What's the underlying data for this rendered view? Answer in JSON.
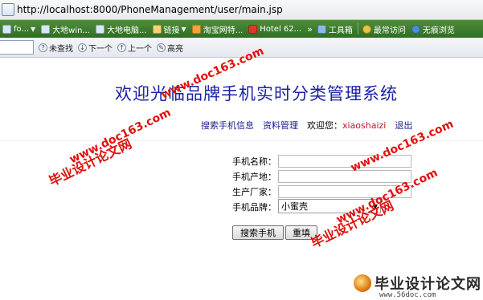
{
  "browser": {
    "url": "http://localhost:8000/PhoneManagement/user/main.jsp",
    "favorites": [
      {
        "label": "fo...",
        "icon": "page-icon",
        "has_menu": true
      },
      {
        "label": "大地win...",
        "icon": "page-icon",
        "has_menu": false
      },
      {
        "label": "大地电脑...",
        "icon": "page-icon",
        "has_menu": false
      },
      {
        "label": "链接",
        "icon": "folder-icon",
        "has_menu": true
      },
      {
        "label": "淘宝网特...",
        "icon": "taobao-icon",
        "has_menu": false
      },
      {
        "label": "Hotel 62...",
        "icon": "hotel-icon",
        "has_menu": false
      }
    ],
    "favorites_overflow": "»",
    "toolbar": [
      {
        "label": "工具箱",
        "icon": "toolbox-icon"
      },
      {
        "label": "最常访问",
        "icon": "most-visited-icon"
      },
      {
        "label": "无痕浏览",
        "icon": "private-browsing-icon"
      }
    ],
    "findbar": {
      "not_found": "未查找",
      "next": "下一个",
      "previous": "上一个",
      "highlight": "高亮"
    }
  },
  "page": {
    "title": "欢迎光临品牌手机实时分类管理系统",
    "nav": {
      "search_phone": "搜索手机信息",
      "profile": "资料管理",
      "welcome": "欢迎您：",
      "username": "xiaoshaizi",
      "logout": "退出"
    },
    "form": {
      "name_label": "手机名称：",
      "origin_label": "手机产地：",
      "maker_label": "生产厂家：",
      "brand_label": "手机品牌：",
      "brand_selected": "小蜜壳",
      "search_button": "搜索手机",
      "clear_button": "重填"
    }
  },
  "watermarks": {
    "cn": "毕业设计论文网",
    "en": "www.doc163.com",
    "footer_cn": "毕业设计论文网",
    "footer_url": "www.56doc.com"
  },
  "colors": {
    "title": "#1a22a5",
    "nav_link": "#1c1c8a",
    "username": "#c0122c",
    "watermark": "#e0110e",
    "favbar": "#3d7d2e"
  }
}
